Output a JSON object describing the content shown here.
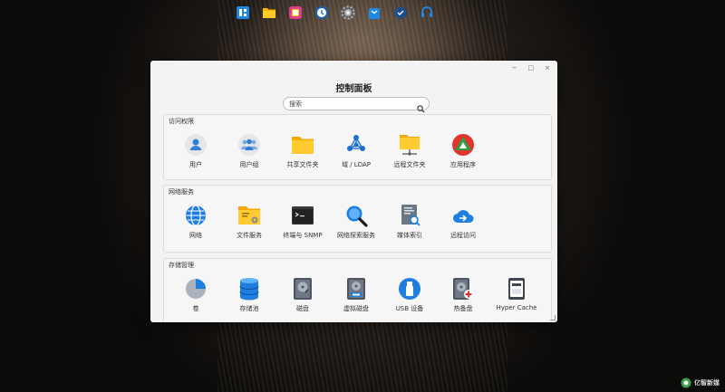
{
  "dock": {
    "items": [
      {
        "name": "main-menu",
        "icon": "grid-icon"
      },
      {
        "name": "file-station",
        "icon": "folder-icon"
      },
      {
        "name": "photos",
        "icon": "photo-icon"
      },
      {
        "name": "clock",
        "icon": "clock-icon"
      },
      {
        "name": "settings",
        "icon": "gear-icon"
      },
      {
        "name": "package-center",
        "icon": "bag-icon"
      },
      {
        "name": "container",
        "icon": "cube-icon"
      },
      {
        "name": "support",
        "icon": "headset-icon"
      }
    ]
  },
  "window": {
    "title": "控制面板",
    "controls": {
      "minimize": "−",
      "maximize": "□",
      "close": "×"
    },
    "search": {
      "placeholder": "搜索"
    },
    "sections": [
      {
        "title": "访问权限",
        "items": [
          {
            "label": "用户",
            "icon": "user-icon"
          },
          {
            "label": "用户组",
            "icon": "user-group-icon"
          },
          {
            "label": "共享文件夹",
            "icon": "shared-folder-icon"
          },
          {
            "label": "域 / LDAP",
            "icon": "ldap-icon"
          },
          {
            "label": "远程文件夹",
            "icon": "remote-folder-icon"
          },
          {
            "label": "应用程序",
            "icon": "application-icon"
          }
        ]
      },
      {
        "title": "网络服务",
        "items": [
          {
            "label": "网络",
            "icon": "globe-icon"
          },
          {
            "label": "文件服务",
            "icon": "file-service-icon"
          },
          {
            "label": "终端与 SNMP",
            "icon": "terminal-icon"
          },
          {
            "label": "网络探索服务",
            "icon": "magnifier-icon"
          },
          {
            "label": "媒体索引",
            "icon": "media-index-icon"
          },
          {
            "label": "远程访问",
            "icon": "cloud-access-icon"
          }
        ]
      },
      {
        "title": "存储管理",
        "items": [
          {
            "label": "卷",
            "icon": "pie-icon"
          },
          {
            "label": "存储池",
            "icon": "database-icon"
          },
          {
            "label": "磁盘",
            "icon": "hard-disk-icon"
          },
          {
            "label": "虚拟磁盘",
            "icon": "virtual-disk-icon"
          },
          {
            "label": "USB 设备",
            "icon": "usb-icon"
          },
          {
            "label": "热备盘",
            "icon": "hot-spare-icon"
          },
          {
            "label": "Hyper Cache",
            "icon": "ssd-icon"
          }
        ]
      }
    ]
  },
  "watermark": {
    "text": "亿智新媒"
  }
}
